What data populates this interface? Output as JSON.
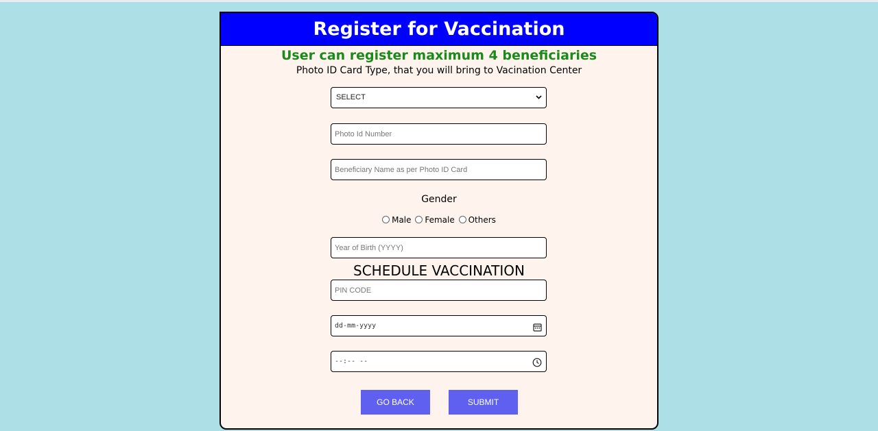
{
  "header": {
    "title": "Register for Vaccination"
  },
  "subtitle": "User can register maximum 4 beneficiaries",
  "id_type_hint": "Photo ID Card Type, that you will bring to Vacination Center",
  "id_type_select": {
    "selected": "SELECT"
  },
  "photo_id": {
    "placeholder": "Photo Id Number"
  },
  "beneficiary_name": {
    "placeholder": "Beneficiary Name as per Photo ID Card"
  },
  "gender": {
    "label": "Gender",
    "options": [
      "Male",
      "Female",
      "Others"
    ]
  },
  "year_of_birth": {
    "placeholder": "Year of Birth (YYYY)"
  },
  "schedule": {
    "title": "SCHEDULE VACCINATION",
    "pin_placeholder": "PIN CODE",
    "date_value": "dd-mm-yyyy",
    "time_value": "--:-- --"
  },
  "buttons": {
    "back": "GO BACK",
    "submit": "SUBMIT"
  },
  "colors": {
    "page_bg": "#ade0e6",
    "header_bg": "#0000ff",
    "subtitle": "#1a8a1a",
    "button": "#6060f0",
    "card_bg": "#fff3ed"
  },
  "icons": {
    "select": "chevron-down-icon",
    "date": "calendar-icon",
    "time": "clock-icon"
  }
}
